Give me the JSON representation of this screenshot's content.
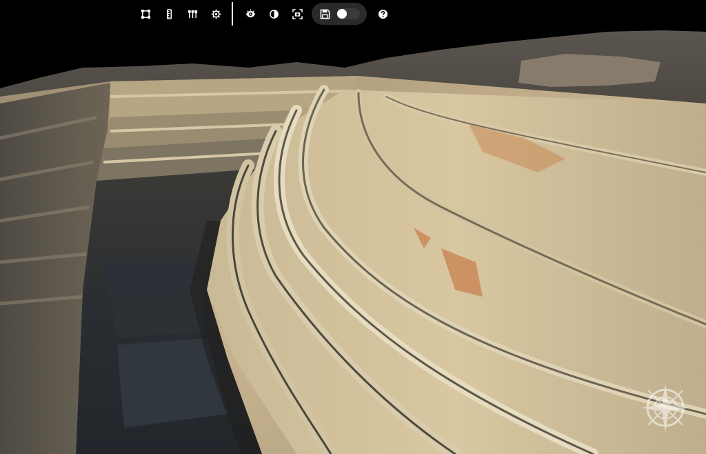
{
  "viewer": {
    "scene": "3d-model-open-pit-quarry",
    "background_color": "#000000"
  },
  "toolbar": {
    "left_tools": [
      {
        "name": "area-measure-tool",
        "icon": "bounding-square-icon"
      },
      {
        "name": "height-measure-tool",
        "icon": "ruler-icon"
      },
      {
        "name": "volume-tool",
        "icon": "chisel-tools-icon"
      },
      {
        "name": "settings",
        "icon": "gear-icon"
      }
    ],
    "right_tools": [
      {
        "name": "visibility",
        "icon": "eye-icon"
      },
      {
        "name": "contrast",
        "icon": "half-circle-icon"
      },
      {
        "name": "screenshot",
        "icon": "camera-frame-icon"
      }
    ],
    "save_group": {
      "icon": "floppy-disk-icon",
      "toggle_on": false
    },
    "help": {
      "icon": "question-circle-icon"
    },
    "icon_color": "#ffffff"
  },
  "compass": {
    "icon": "compass-rose-icon"
  }
}
